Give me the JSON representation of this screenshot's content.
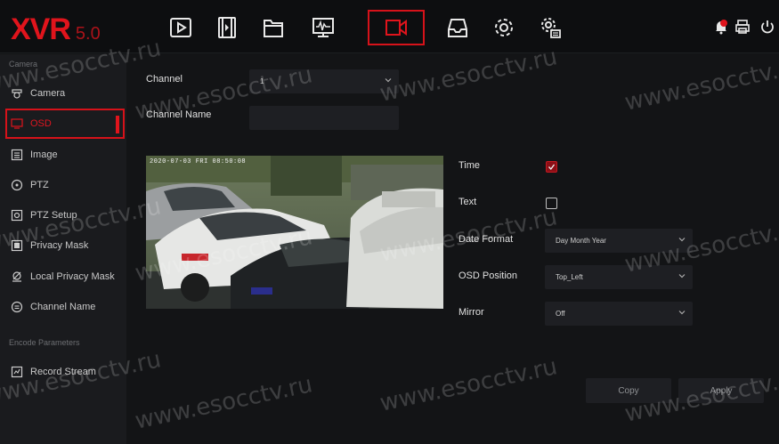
{
  "logo": {
    "brand": "XVR",
    "version": "5.0"
  },
  "nav": {
    "icons": [
      "playback-icon",
      "video-clips-icon",
      "files-icon",
      "monitor-icon",
      "camera-icon",
      "storage-icon",
      "settings-icon",
      "system-settings-icon"
    ],
    "active": "camera-icon"
  },
  "top_right_icons": [
    "alarm-bell-icon",
    "print-icon",
    "power-icon"
  ],
  "sidebar": {
    "section_camera": "Camera",
    "section_encode": "Encode Parameters",
    "items": [
      {
        "label": "Camera",
        "icon": "camera-icon"
      },
      {
        "label": "OSD",
        "icon": "monitor-icon"
      },
      {
        "label": "Image",
        "icon": "image-icon"
      },
      {
        "label": "PTZ",
        "icon": "ptz-icon"
      },
      {
        "label": "PTZ Setup",
        "icon": "ptz-setup-icon"
      },
      {
        "label": "Privacy Mask",
        "icon": "privacy-mask-icon"
      },
      {
        "label": "Local Privacy Mask",
        "icon": "local-privacy-mask-icon"
      },
      {
        "label": "Channel Name",
        "icon": "channel-name-icon"
      },
      {
        "label": "Record Stream",
        "icon": "record-stream-icon"
      }
    ]
  },
  "form": {
    "channel_label": "Channel",
    "channel_value": "1",
    "channel_name_label": "Channel Name",
    "channel_name_value": "",
    "time_label": "Time",
    "time_checked": true,
    "text_label": "Text",
    "text_checked": false,
    "date_format_label": "Date Format",
    "date_format_value": "Day Month Year",
    "osd_position_label": "OSD Position",
    "osd_position_value": "Top_Left",
    "mirror_label": "Mirror",
    "mirror_value": "Off"
  },
  "preview": {
    "timestamp": "2020-07-03 FRI 08:50:08"
  },
  "buttons": {
    "copy": "Copy",
    "apply": "Apply"
  },
  "watermark": "www.esocctv.ru",
  "colors": {
    "accent": "#e0141c",
    "background": "#121315",
    "sidebar": "#1a1b1e",
    "field": "#1e1f23"
  }
}
